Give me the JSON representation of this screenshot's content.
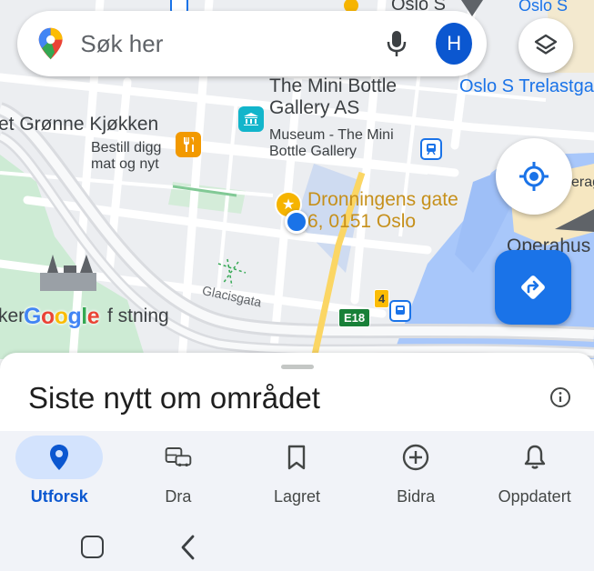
{
  "search": {
    "placeholder": "Søk her",
    "avatar_initial": "H"
  },
  "map": {
    "labels": {
      "mini_bottle": "The Mini Bottle\nGallery AS",
      "mini_bottle_sub": "Museum - The Mini\nBottle Gallery",
      "oslo_s_trelast": "Oslo S Trelastga",
      "gronne": "et Grønne Kjøkken",
      "gronne_sub": "Bestill digg\nmat og nyt",
      "dronningens": "Dronningens gate\n6, 0151 Oslo",
      "glacisgata": "Glacisgata",
      "festning": "ker",
      "festning_tail": "f  stning",
      "operahus": "Operahus",
      "erag": "erag",
      "oslo_top": "Oslo S",
      "oslo_s_top": "Oslo S"
    },
    "shields": {
      "e18": "E18",
      "route4": "4"
    },
    "google_logo": [
      "G",
      "o",
      "o",
      "g",
      "l",
      "e"
    ],
    "google_colors": [
      "#4285f4",
      "#ea4335",
      "#fbbc04",
      "#4285f4",
      "#34a853",
      "#ea4335"
    ]
  },
  "sheet": {
    "title": "Siste nytt om området"
  },
  "nav": [
    {
      "label": "Utforsk",
      "icon": "explore-pin-icon",
      "active": true
    },
    {
      "label": "Dra",
      "icon": "commute-icon",
      "active": false
    },
    {
      "label": "Lagret",
      "icon": "bookmark-icon",
      "active": false
    },
    {
      "label": "Bidra",
      "icon": "add-circle-icon",
      "active": false
    },
    {
      "label": "Oppdatert",
      "icon": "bell-icon",
      "active": false
    }
  ],
  "colors": {
    "accent": "#1a73e8",
    "active_pill": "#d3e3fd",
    "water": "#a8c7fa"
  }
}
